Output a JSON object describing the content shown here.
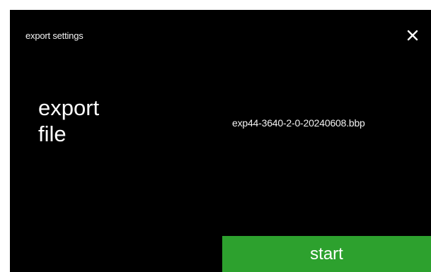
{
  "screen": {
    "title": "export settings",
    "close_icon": "close-icon"
  },
  "export": {
    "label_line1": "export",
    "label_line2": "file",
    "filename": "exp44-3640-2-0-20240608.bbp"
  },
  "actions": {
    "start_label": "start"
  },
  "colors": {
    "background": "#000000",
    "frame": "#ffffff",
    "start_button": "#2da12e",
    "text": "#ffffff"
  }
}
